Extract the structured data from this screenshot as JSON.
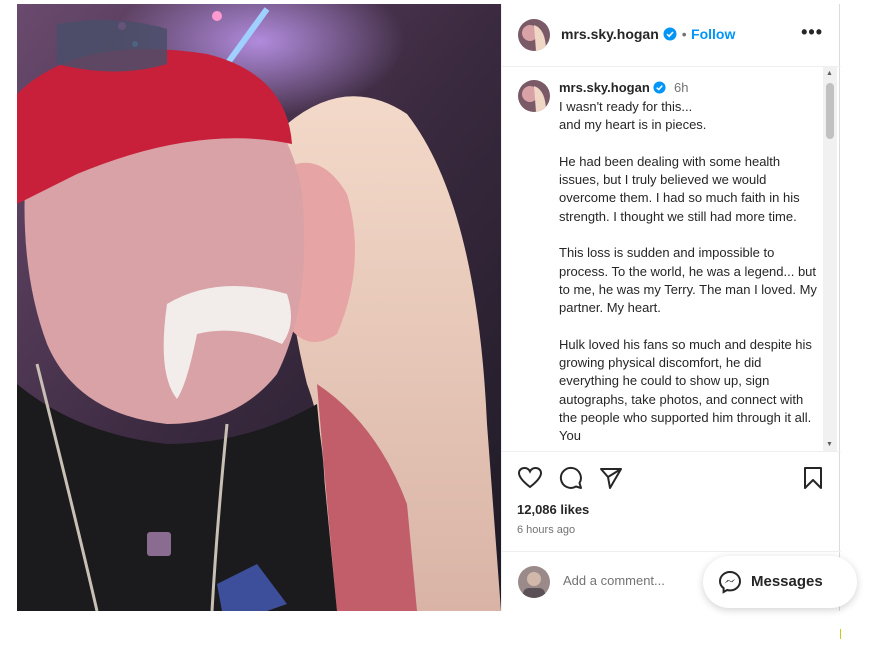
{
  "post": {
    "username": "mrs.sky.hogan",
    "follow_label": "Follow",
    "dot": "•",
    "more": "•••",
    "caption_age": "6h",
    "caption": "I wasn't ready for this...\nand my heart is in pieces.\n\nHe had been dealing with some health issues, but I truly believed we would overcome them. I had so much faith in his strength. I thought we still had more time.\n\nThis loss is sudden and impossible to process. To the world, he was a legend... but to me, he was my Terry. The man I loved. My partner. My heart.\n\nHulk loved his fans so much and despite his growing physical discomfort, he did everything he could to show up, sign autographs, take photos, and connect with the people who supported him through it all. You",
    "likes": "12,086 likes",
    "time_ago": "6 hours ago",
    "comment_placeholder": "Add a comment..."
  },
  "icons": {
    "like": "heart-icon",
    "comment": "comment-icon",
    "share": "share-icon",
    "save": "bookmark-icon",
    "verified": "verified-badge-icon"
  },
  "messages_button": {
    "label": "Messages"
  },
  "colors": {
    "link": "#0095f6",
    "verified": "#0095f6"
  }
}
